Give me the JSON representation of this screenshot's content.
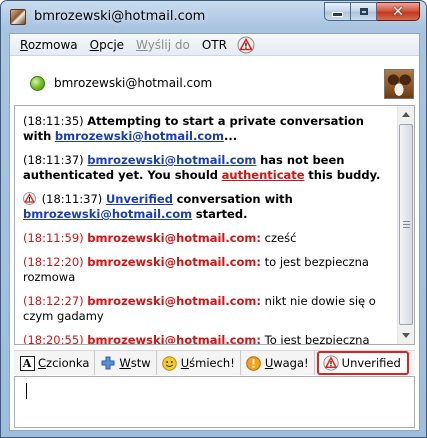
{
  "window": {
    "title": "bmrozewski@hotmail.com"
  },
  "menu": {
    "items": [
      {
        "label": "Rozmowa",
        "accel": "R",
        "rest": "ozmowa",
        "enabled": true
      },
      {
        "label": "Opcje",
        "accel": "O",
        "rest": "pcje",
        "enabled": true
      },
      {
        "label": "Wyślij do",
        "accel": "W",
        "rest": "yślij do",
        "enabled": false
      },
      {
        "label": "OTR",
        "accel": "",
        "rest": "OTR",
        "enabled": true
      }
    ],
    "otr_icon": "unverified-warning-icon"
  },
  "buddy": {
    "name": "bmrozewski@hotmail.com",
    "status": "available",
    "status_color": "#7ec62f"
  },
  "conversation": {
    "system_messages": {
      "m1": {
        "time": "(18:11:35)",
        "text": "Attempting to start a private conversation with",
        "link": "bmrozewski@hotmail.com",
        "tail": "..."
      },
      "m2": {
        "time": "(18:11:37)",
        "link": "bmrozewski@hotmail.com",
        "text_a": "has not been authenticated yet.  You should",
        "auth_link": "authenticate",
        "text_b": "this buddy."
      },
      "m3": {
        "time": "(18:11:37)",
        "link_unverified": "Unverified",
        "text_a": "conversation with",
        "link": "bmrozewski@hotmail.com",
        "text_b": "started."
      }
    },
    "chat_messages": [
      {
        "time": "(18:11:59)",
        "speaker": "bmrozewski@hotmail.com:",
        "text": "cześć"
      },
      {
        "time": "(18:12:20)",
        "speaker": "bmrozewski@hotmail.com:",
        "text": "to jest bezpieczna rozmowa"
      },
      {
        "time": "(18:12:27)",
        "speaker": "bmrozewski@hotmail.com:",
        "text": "nikt nie dowie się o czym gadamy"
      },
      {
        "time": "(18:20:55)",
        "speaker": "bmrozewski@hotmail.com:",
        "text": "To jest bezpieczna konwersacja"
      }
    ]
  },
  "toolbar": {
    "font": {
      "accel": "C",
      "rest": "zcionka"
    },
    "insert": {
      "accel": "W",
      "rest": "stw"
    },
    "smile": {
      "accel": "U",
      "rest": "śmiech!"
    },
    "attention": {
      "accel": "U",
      "rest": "waga!"
    },
    "otr_status": "Unverified"
  },
  "colors": {
    "speaker": "#cc1616",
    "link": "#1c3fb0",
    "unverified_border": "#d9261c"
  }
}
